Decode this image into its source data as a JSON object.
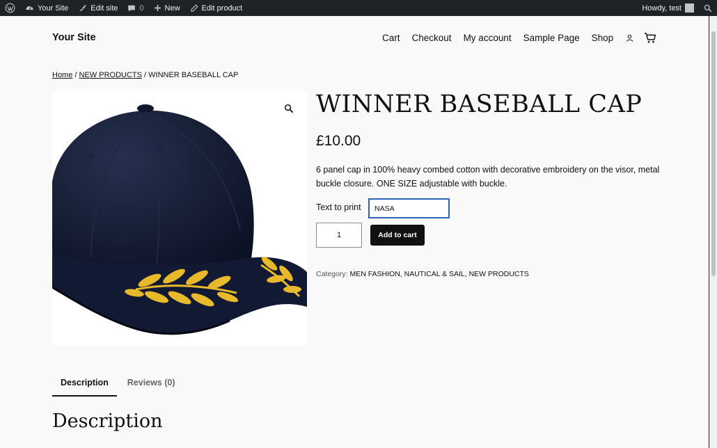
{
  "admin_bar": {
    "site_name": "Your Site",
    "edit_site": "Edit site",
    "comments_count": "0",
    "new_label": "New",
    "edit_product": "Edit product",
    "howdy": "Howdy, test"
  },
  "header": {
    "site_title": "Your Site",
    "nav": [
      "Cart",
      "Checkout",
      "My account",
      "Sample Page",
      "Shop"
    ]
  },
  "breadcrumb": {
    "home": "Home",
    "separator": " / ",
    "category": "NEW PRODUCTS",
    "current": "WINNER BASEBALL CAP"
  },
  "product": {
    "title": "WINNER BASEBALL CAP",
    "price": "£10.00",
    "short_description": "6 panel cap in 100% heavy combed cotton with decorative embroidery on the visor, metal buckle closure. ONE SIZE adjustable with buckle.",
    "text_to_print_label": "Text to print",
    "text_to_print_value": "NASA",
    "quantity": "1",
    "add_to_cart": "Add to cart",
    "category_label": "Category:",
    "categories": "MEN FASHION, NAUTICAL & SAIL, NEW PRODUCTS"
  },
  "tabs": {
    "description": "Description",
    "reviews": "Reviews (0)"
  },
  "description_heading": "Description",
  "colors": {
    "admin_bar": "#1d2327",
    "cap_navy": "#101a33",
    "embroidery_gold": "#e8b92a",
    "focus_blue": "#2f63b5",
    "button_black": "#111111"
  }
}
